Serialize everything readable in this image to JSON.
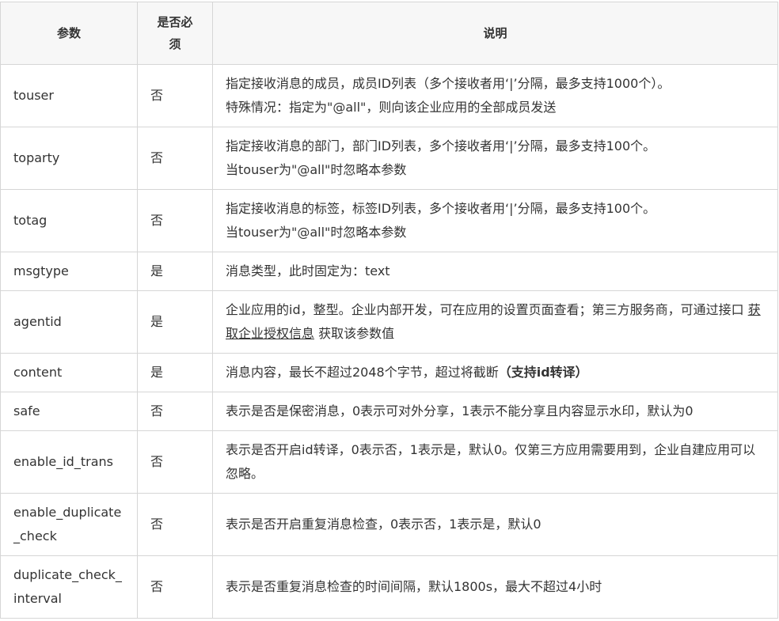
{
  "header": {
    "param": "参数",
    "required": "是否必须",
    "desc": "说明"
  },
  "rows": [
    {
      "name": "touser",
      "required": "否",
      "desc_line1": "指定接收消息的成员，成员ID列表（多个接收者用‘|’分隔，最多支持1000个）。",
      "desc_line2": "特殊情况：指定为\"@all\"，则向该企业应用的全部成员发送"
    },
    {
      "name": "toparty",
      "required": "否",
      "desc_line1": "指定接收消息的部门，部门ID列表，多个接收者用‘|’分隔，最多支持100个。",
      "desc_line2": "当touser为\"@all\"时忽略本参数"
    },
    {
      "name": "totag",
      "required": "否",
      "desc_line1": "指定接收消息的标签，标签ID列表，多个接收者用‘|’分隔，最多支持100个。",
      "desc_line2": "当touser为\"@all\"时忽略本参数"
    },
    {
      "name": "msgtype",
      "required": "是",
      "desc": "消息类型，此时固定为：text"
    },
    {
      "name": "agentid",
      "required": "是",
      "desc_before": "企业应用的id，整型。企业内部开发，可在应用的设置页面查看；第三方服务商，可通过接口 ",
      "desc_link": "获取企业授权信息",
      "desc_after": " 获取该参数值"
    },
    {
      "name": "content",
      "required": "是",
      "desc_before": "消息内容，最长不超过2048个字节，超过将截断",
      "desc_bold": "（支持id转译）"
    },
    {
      "name": "safe",
      "required": "否",
      "desc": "表示是否是保密消息，0表示可对外分享，1表示不能分享且内容显示水印，默认为0"
    },
    {
      "name": "enable_id_trans",
      "required": "否",
      "desc": "表示是否开启id转译，0表示否，1表示是，默认0。仅第三方应用需要用到，企业自建应用可以忽略。"
    },
    {
      "name": "enable_duplicate_check",
      "required": "否",
      "desc": "表示是否开启重复消息检查，0表示否，1表示是，默认0"
    },
    {
      "name": "duplicate_check_interval",
      "required": "否",
      "desc": "表示是否重复消息检查的时间间隔，默认1800s，最大不超过4小时"
    }
  ]
}
